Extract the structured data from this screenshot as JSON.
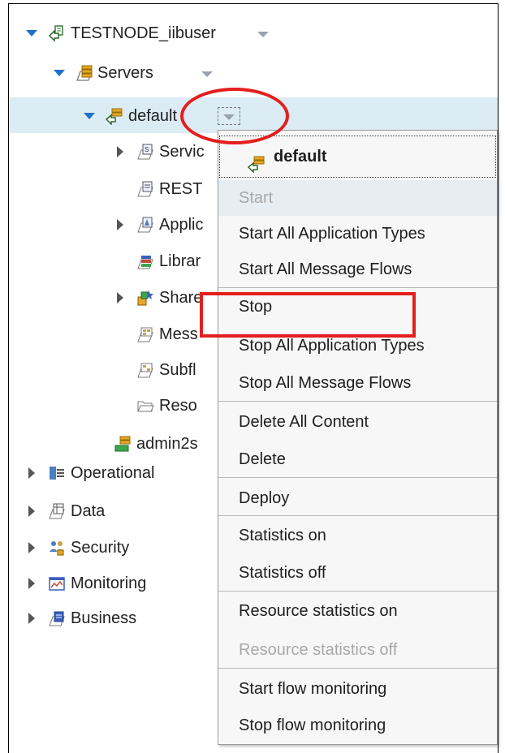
{
  "tree": {
    "node": "TESTNODE_iibuser",
    "servers": "Servers",
    "default": "default",
    "children": [
      "Servic",
      "REST",
      "Applic",
      "Librar",
      "Share",
      "Mess",
      "Subfl",
      "Reso"
    ],
    "admin": "admin2s",
    "roots": [
      "Operational",
      "Data",
      "Security",
      "Monitoring",
      "Business"
    ]
  },
  "menu": {
    "header": "default",
    "items": {
      "start": "Start",
      "start_all_app": "Start All Application Types",
      "start_all_flows": "Start All Message Flows",
      "stop": "Stop",
      "stop_all_app": "Stop All Application Types",
      "stop_all_flows": "Stop All Message Flows",
      "delete_all": "Delete All Content",
      "delete": "Delete",
      "deploy": "Deploy",
      "stats_on": "Statistics on",
      "stats_off": "Statistics off",
      "res_stats_on": "Resource statistics on",
      "res_stats_off": "Resource statistics off",
      "start_flow_mon": "Start flow monitoring",
      "stop_flow_mon": "Stop flow monitoring"
    }
  },
  "colors": {
    "accent": "#1f72c8",
    "highlight_red": "#e41e1e",
    "selection": "#dcecf5"
  }
}
